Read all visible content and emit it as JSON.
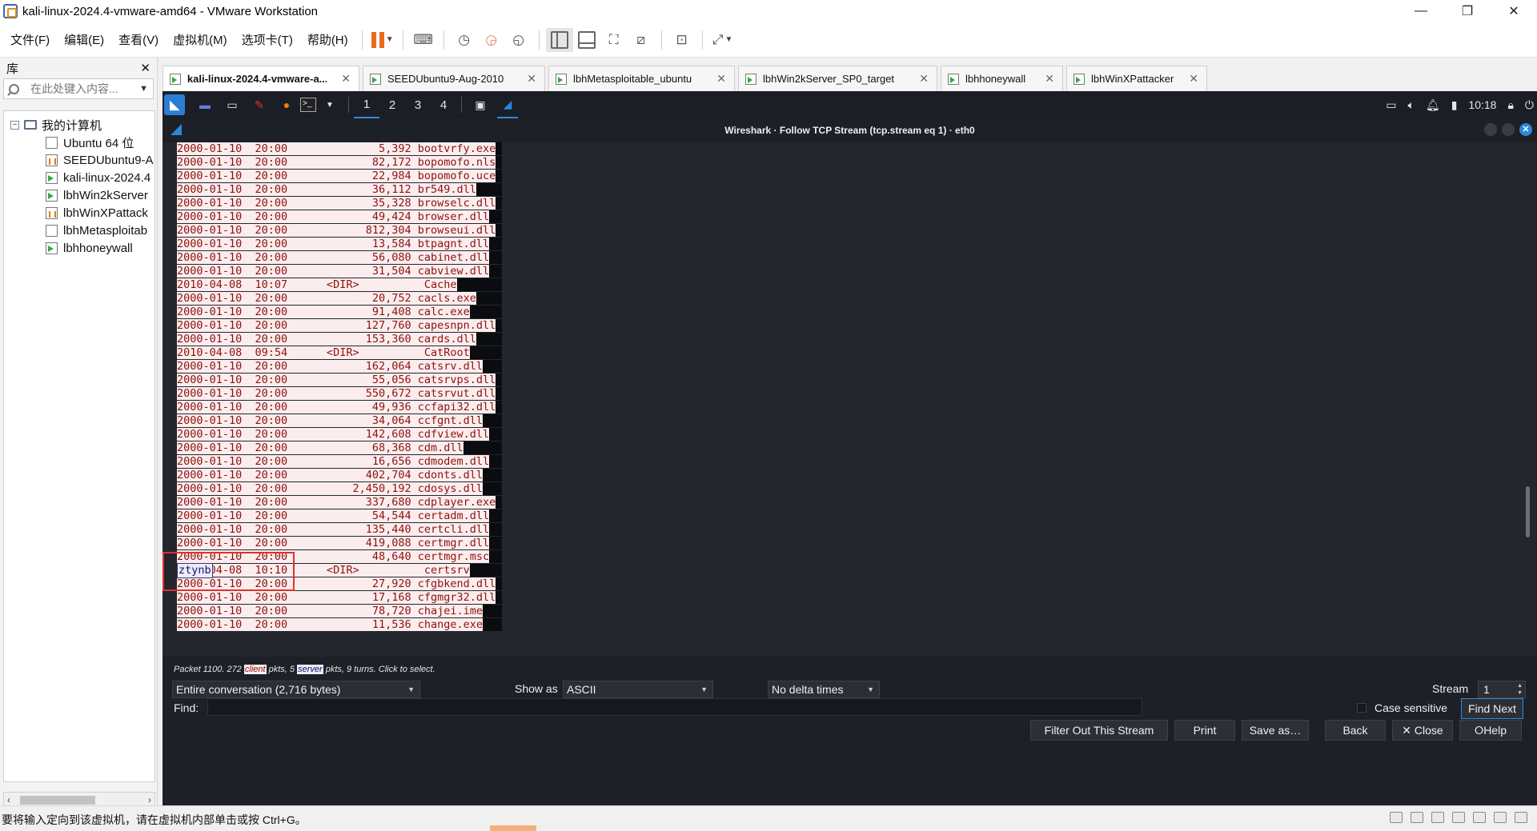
{
  "window": {
    "title": "kali-linux-2024.4-vmware-amd64 - VMware Workstation",
    "minimize_glyph": "—",
    "restore_glyph": "❐",
    "close_glyph": "✕"
  },
  "menu": [
    "文件(F)",
    "编辑(E)",
    "查看(V)",
    "虚拟机(M)",
    "选项卡(T)",
    "帮助(H)"
  ],
  "library": {
    "title": "库",
    "close_glyph": "✕",
    "search_placeholder": "在此处键入内容...",
    "root": "我的计算机",
    "items": [
      {
        "label": "Ubuntu 64 位",
        "state": "off"
      },
      {
        "label": "SEEDUbuntu9-A",
        "state": "pause"
      },
      {
        "label": "kali-linux-2024.4",
        "state": "run"
      },
      {
        "label": "lbhWin2kServer",
        "state": "run"
      },
      {
        "label": "lbhWinXPattack",
        "state": "pause"
      },
      {
        "label": "lbhMetasploitab",
        "state": "off"
      },
      {
        "label": "lbhhoneywall",
        "state": "run"
      }
    ]
  },
  "tabs": [
    {
      "label": "kali-linux-2024.4-vmware-a...",
      "active": true
    },
    {
      "label": "SEEDUbuntu9-Aug-2010",
      "active": false
    },
    {
      "label": "lbhMetasploitable_ubuntu",
      "active": false
    },
    {
      "label": "lbhWin2kServer_SP0_target",
      "active": false
    },
    {
      "label": "lbhhoneywall",
      "active": false
    },
    {
      "label": "lbhWinXPattacker",
      "active": false
    }
  ],
  "kali_panel": {
    "workspaces": [
      "1",
      "2",
      "3",
      "4"
    ],
    "terminal_glyph": ">_",
    "clock": "10:18"
  },
  "wireshark": {
    "window_title": "Wireshark · Follow TCP Stream (tcp.stream eq 1) · eth0",
    "client_lines": [
      "2000-01-10  20:00              5,392 bootvrfy.exe",
      "2000-01-10  20:00             82,172 bopomofo.nls",
      "2000-01-10  20:00             22,984 bopomofo.uce",
      "2000-01-10  20:00             36,112 br549.dll",
      "2000-01-10  20:00             35,328 browselc.dll",
      "2000-01-10  20:00             49,424 browser.dll",
      "2000-01-10  20:00            812,304 browseui.dll",
      "2000-01-10  20:00             13,584 btpagnt.dll",
      "2000-01-10  20:00             56,080 cabinet.dll",
      "2000-01-10  20:00             31,504 cabview.dll",
      "2010-04-08  10:07      <DIR>          Cache",
      "2000-01-10  20:00             20,752 cacls.exe",
      "2000-01-10  20:00             91,408 calc.exe",
      "2000-01-10  20:00            127,760 capesnpn.dll",
      "2000-01-10  20:00            153,360 cards.dll",
      "2010-04-08  09:54      <DIR>          CatRoot",
      "2000-01-10  20:00            162,064 catsrv.dll",
      "2000-01-10  20:00             55,056 catsrvps.dll",
      "2000-01-10  20:00            550,672 catsrvut.dll",
      "2000-01-10  20:00             49,936 ccfapi32.dll",
      "2000-01-10  20:00             34,064 ccfgnt.dll",
      "2000-01-10  20:00            142,608 cdfview.dll",
      "2000-01-10  20:00             68,368 cdm.dll",
      "2000-01-10  20:00             16,656 cdmodem.dll",
      "2000-01-10  20:00            402,704 cdonts.dll",
      "2000-01-10  20:00          2,450,192 cdosys.dll",
      "2000-01-10  20:00            337,680 cdplayer.exe",
      "2000-01-10  20:00             54,544 certadm.dll",
      "2000-01-10  20:00            135,440 certcli.dll",
      "2000-01-10  20:00            419,088 certmgr.dll",
      "2000-01-10  20:00             48,640 certmgr.msc",
      "2010-04-08  10:10      <DIR>          certsrv",
      "2000-01-10  20:00             27,920 cfgbkend.dll",
      "2000-01-10  20:00             17,168 cfgmgr32.dll",
      "2000-01-10  20:00             78,720 chajei.ime",
      "2000-01-10  20:00             11,536 change.exe"
    ],
    "server_text": "ztynb",
    "packet_info": {
      "prefix": "Packet 1100. 272",
      "client_tag": "client",
      "middle": "pkts, 5",
      "server_tag": "server",
      "suffix": "pkts, 9 turns. Click to select."
    },
    "conversation": "Entire conversation (2,716 bytes)",
    "show_as_label": "Show as",
    "show_as": "ASCII",
    "delta": "No delta times",
    "stream_label": "Stream",
    "stream": "1",
    "find_label": "Find:",
    "case_sensitive": "Case sensitive",
    "buttons": {
      "find_next": "Find Next",
      "filter_out": "Filter Out This Stream",
      "print": "Print",
      "save_as": "Save as…",
      "back": "Back",
      "close": "✕ Close",
      "help": "⭘Help"
    }
  },
  "status_text": "要将输入定向到该虚拟机，请在虚拟机内部单击或按 Ctrl+G。",
  "colors": {
    "client_bg": "#fbeded",
    "client_fg": "#8e1111",
    "server_bg": "#ececf8",
    "server_fg": "#13136b",
    "highlight_box": "#e0302d",
    "accent": "#2d8ae0"
  }
}
